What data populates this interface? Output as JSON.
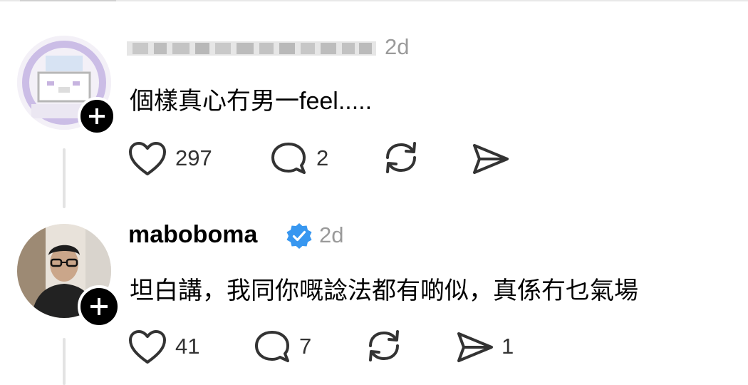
{
  "comments": [
    {
      "username": "",
      "username_masked": true,
      "time": "2d",
      "text": "個樣真心冇男一feel.....",
      "stats": {
        "likes": "297",
        "replies": "2",
        "reposts": "",
        "shares": ""
      }
    },
    {
      "username": "maboboma",
      "verified": true,
      "time": "2d",
      "text": "坦白講，我同你嘅諗法都有啲似，真係冇乜氣場",
      "stats": {
        "likes": "41",
        "replies": "7",
        "reposts": "",
        "shares": "1"
      }
    }
  ],
  "icons": {
    "like": "heart-icon",
    "reply": "comment-bubble-icon",
    "repost": "repost-icon",
    "share": "send-icon",
    "follow": "plus-icon",
    "verified": "verified-badge-icon"
  },
  "colors": {
    "verified": "#3897f0",
    "muted": "#9a9a9a",
    "icon": "#333333"
  }
}
